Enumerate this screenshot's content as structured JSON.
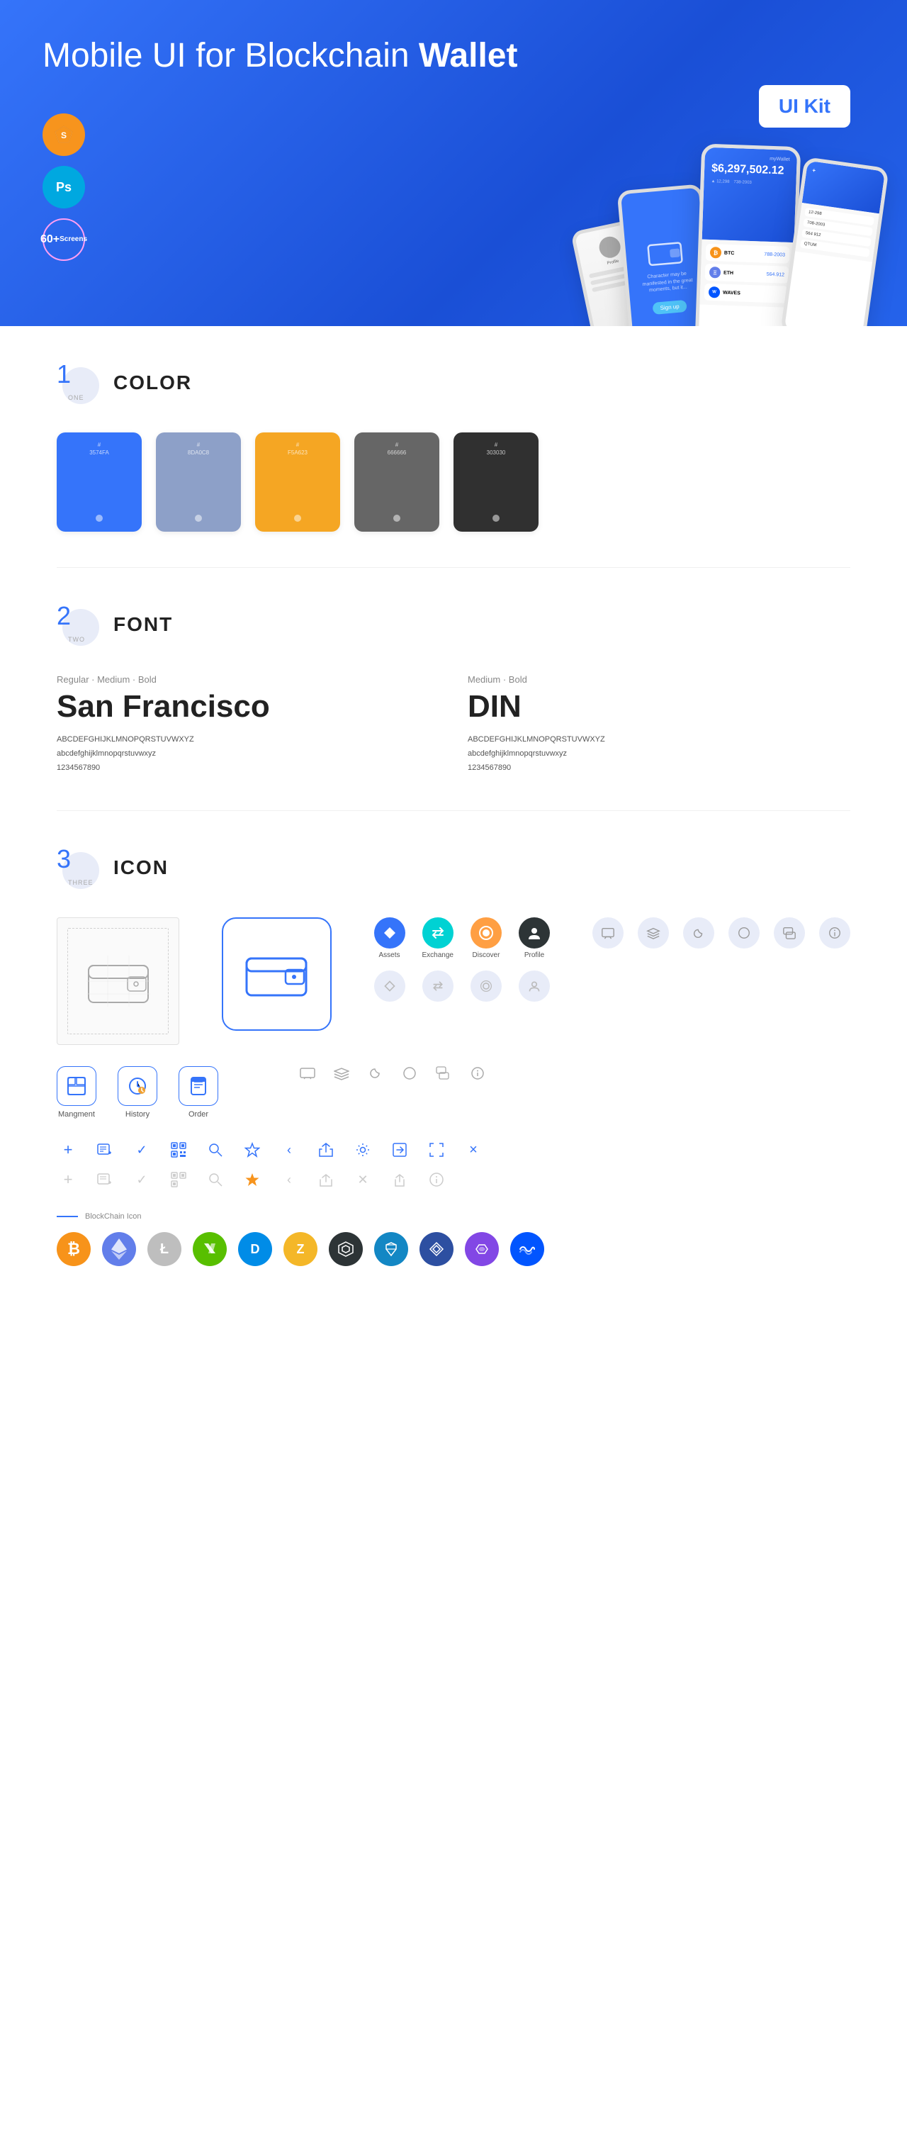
{
  "hero": {
    "title_regular": "Mobile UI for Blockchain ",
    "title_bold": "Wallet",
    "ui_kit_label": "UI Kit",
    "sketch_label": "S",
    "ps_label": "Ps",
    "screens_label": "60+\nScreens"
  },
  "sections": {
    "color": {
      "number": "1",
      "number_label": "ONE",
      "title": "COLOR",
      "swatches": [
        {
          "hex": "#3574FA",
          "label": "#\n3574FA",
          "dark_text": false
        },
        {
          "hex": "#8DA0C8",
          "label": "#\n8DA0C8",
          "dark_text": false
        },
        {
          "hex": "#F5A623",
          "label": "#\nF5A623",
          "dark_text": false
        },
        {
          "hex": "#666666",
          "label": "#\n666666",
          "dark_text": false
        },
        {
          "hex": "#303030",
          "label": "#\n303030",
          "dark_text": false
        }
      ]
    },
    "font": {
      "number": "2",
      "number_label": "TWO",
      "title": "FONT",
      "fonts": [
        {
          "style_label": "Regular · Medium · Bold",
          "name": "San Francisco",
          "uppercase": "ABCDEFGHIJKLMNOPQRSTUVWXYZ",
          "lowercase": "abcdefghijklmnopqrstuvwxyz",
          "numbers": "1234567890"
        },
        {
          "style_label": "Medium · Bold",
          "name": "DIN",
          "uppercase": "ABCDEFGHIJKLMNOPQRSTUVWXYZ",
          "lowercase": "abcdefghijklmnopqrstuvwxyz",
          "numbers": "1234567890"
        }
      ]
    },
    "icon": {
      "number": "3",
      "number_label": "THREE",
      "title": "ICON",
      "nav_items": [
        {
          "label": "Assets",
          "icon": "◆"
        },
        {
          "label": "Exchange",
          "icon": "⇄"
        },
        {
          "label": "Discover",
          "icon": "●"
        },
        {
          "label": "Profile",
          "icon": "👤"
        }
      ],
      "app_icons": [
        {
          "label": "Mangment",
          "icon": "▦"
        },
        {
          "label": "History",
          "icon": "⏱"
        },
        {
          "label": "Order",
          "icon": "📋"
        }
      ],
      "blockchain_label": "BlockChain Icon"
    }
  }
}
